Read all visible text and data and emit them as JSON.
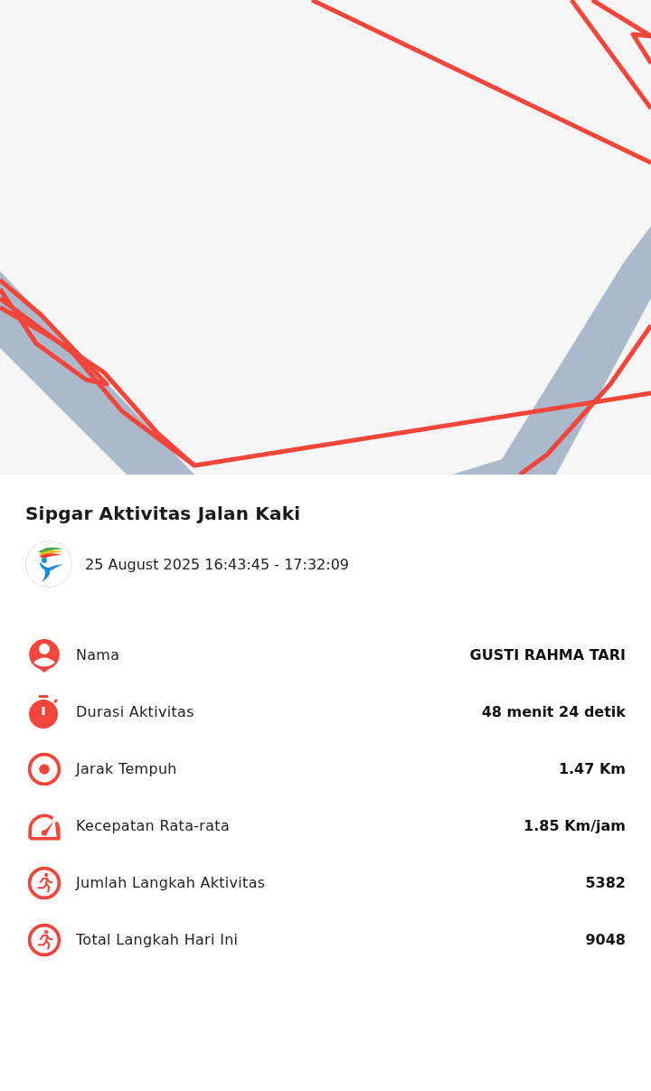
{
  "title": "Sipgar Aktivitas Jalan Kaki",
  "time_range": "25 August 2025 16:43:45 - 17:32:09",
  "stats": [
    {
      "kind": "person",
      "label": "Nama",
      "value": "GUSTI RAHMA TARI"
    },
    {
      "kind": "stopwatch",
      "label": "Durasi Aktivitas",
      "value": "48 menit 24 detik"
    },
    {
      "kind": "target",
      "label": "Jarak Tempuh",
      "value": "1.47 Km"
    },
    {
      "kind": "speedometer",
      "label": "Kecepatan Rata-rata",
      "value": "1.85 Km/jam"
    },
    {
      "kind": "runner",
      "label": "Jumlah Langkah Aktivitas",
      "value": "5382"
    },
    {
      "kind": "runner",
      "label": "Total Langkah Hari Ini",
      "value": "9048"
    }
  ]
}
